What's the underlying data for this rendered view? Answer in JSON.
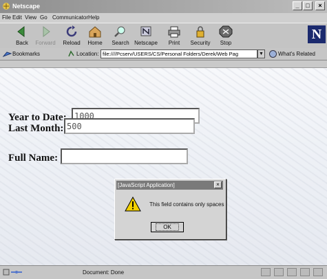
{
  "window": {
    "title": "Netscape"
  },
  "menu": [
    "File",
    "Edit",
    "View",
    "Go",
    "Communicator",
    "Help"
  ],
  "toolbar": {
    "buttons": [
      {
        "label": "Back",
        "icon": "back-arrow-icon"
      },
      {
        "label": "Forward",
        "icon": "forward-arrow-icon",
        "disabled": true
      },
      {
        "label": "Reload",
        "icon": "reload-icon"
      },
      {
        "label": "Home",
        "icon": "home-icon"
      },
      {
        "label": "Search",
        "icon": "search-icon"
      },
      {
        "label": "Netscape",
        "icon": "netscape-icon"
      },
      {
        "label": "Print",
        "icon": "print-icon"
      },
      {
        "label": "Security",
        "icon": "security-icon"
      },
      {
        "label": "Stop",
        "icon": "stop-icon"
      }
    ]
  },
  "location": {
    "bookmarks_label": "Bookmarks",
    "location_label": "Location:",
    "url": "file:////Pcserv/USERS/CS/Personal Folders/Derek/Web Pag",
    "related_label": "What's Related"
  },
  "form": {
    "year_to_date": {
      "label": "Year to Date:",
      "value": "1000"
    },
    "last_month": {
      "label": "Last Month:",
      "value": "500"
    },
    "full_name": {
      "label": "Full Name:",
      "value": ""
    }
  },
  "dialog": {
    "title": "[JavaScript Application]",
    "message": "This field contains only spaces",
    "ok_label": "OK",
    "close_label": "×"
  },
  "status": {
    "text": "Document: Done"
  },
  "colors": {
    "titlebar": "#8e8e8e",
    "chrome": "#c8c8c8",
    "netscape_logo": "#1b2a6e"
  }
}
